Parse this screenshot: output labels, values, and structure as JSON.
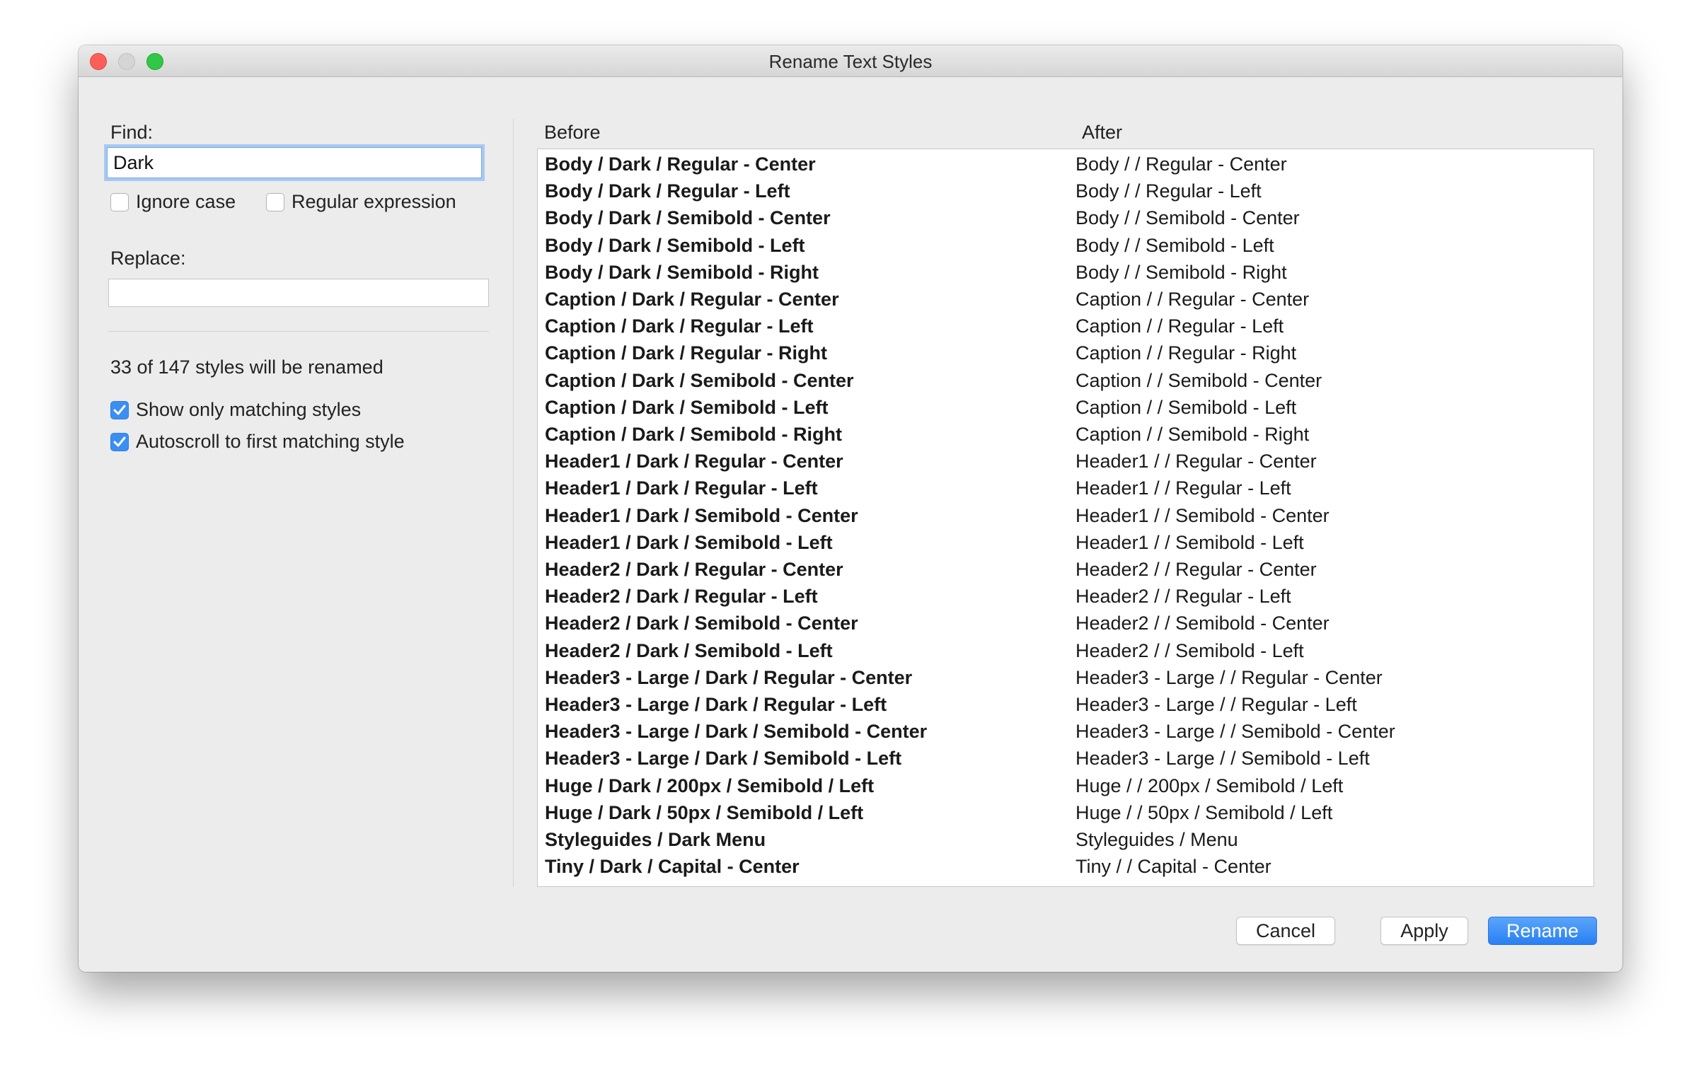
{
  "window": {
    "title": "Rename Text Styles"
  },
  "find": {
    "label": "Find:",
    "value": "Dark"
  },
  "options": {
    "ignore_case": "Ignore case",
    "regex": "Regular expression"
  },
  "replace": {
    "label": "Replace:",
    "value": ""
  },
  "summary": "33 of 147 styles will be renamed",
  "toggles": {
    "show_only": "Show only matching styles",
    "autoscroll": "Autoscroll to first matching style"
  },
  "table": {
    "headers": {
      "before": "Before",
      "after": "After"
    },
    "rows": [
      {
        "before": "Body / Dark / Regular - Center",
        "after": "Body /  / Regular - Center"
      },
      {
        "before": "Body / Dark / Regular - Left",
        "after": "Body /  / Regular - Left"
      },
      {
        "before": "Body / Dark / Semibold - Center",
        "after": "Body /  / Semibold - Center"
      },
      {
        "before": "Body / Dark / Semibold - Left",
        "after": "Body /  / Semibold - Left"
      },
      {
        "before": "Body / Dark / Semibold - Right",
        "after": "Body /  / Semibold - Right"
      },
      {
        "before": "Caption / Dark / Regular - Center",
        "after": "Caption /  / Regular - Center"
      },
      {
        "before": "Caption / Dark / Regular - Left",
        "after": "Caption /  / Regular - Left"
      },
      {
        "before": "Caption / Dark / Regular - Right",
        "after": "Caption /  / Regular - Right"
      },
      {
        "before": "Caption / Dark / Semibold - Center",
        "after": "Caption /  / Semibold - Center"
      },
      {
        "before": "Caption / Dark / Semibold - Left",
        "after": "Caption /  / Semibold - Left"
      },
      {
        "before": "Caption / Dark / Semibold - Right",
        "after": "Caption /  / Semibold - Right"
      },
      {
        "before": "Header1 / Dark / Regular - Center",
        "after": "Header1 /  / Regular - Center"
      },
      {
        "before": "Header1 / Dark / Regular - Left",
        "after": "Header1 /  / Regular - Left"
      },
      {
        "before": "Header1 / Dark / Semibold - Center",
        "after": "Header1 /  / Semibold - Center"
      },
      {
        "before": "Header1 / Dark / Semibold - Left",
        "after": "Header1 /  / Semibold - Left"
      },
      {
        "before": "Header2 / Dark / Regular - Center",
        "after": "Header2 /  / Regular - Center"
      },
      {
        "before": "Header2 / Dark / Regular - Left",
        "after": "Header2 /  / Regular - Left"
      },
      {
        "before": "Header2 / Dark / Semibold - Center",
        "after": "Header2 /  / Semibold - Center"
      },
      {
        "before": "Header2 / Dark / Semibold - Left",
        "after": "Header2 /  / Semibold - Left"
      },
      {
        "before": "Header3 - Large / Dark / Regular - Center",
        "after": "Header3 - Large /  / Regular - Center"
      },
      {
        "before": "Header3 - Large / Dark / Regular - Left",
        "after": "Header3 - Large /  / Regular - Left"
      },
      {
        "before": "Header3 - Large / Dark / Semibold - Center",
        "after": "Header3 - Large /  / Semibold - Center"
      },
      {
        "before": "Header3 - Large / Dark / Semibold - Left",
        "after": "Header3 - Large /  / Semibold - Left"
      },
      {
        "before": "Huge / Dark / 200px / Semibold / Left",
        "after": "Huge /  / 200px / Semibold / Left"
      },
      {
        "before": "Huge / Dark / 50px / Semibold / Left",
        "after": "Huge /  / 50px / Semibold / Left"
      },
      {
        "before": "Styleguides / Dark Menu",
        "after": "Styleguides /  Menu"
      },
      {
        "before": "Tiny / Dark / Capital - Center",
        "after": "Tiny /  / Capital - Center"
      }
    ]
  },
  "buttons": {
    "cancel": "Cancel",
    "apply": "Apply",
    "rename": "Rename"
  },
  "colors": {
    "accent": "#3b8ff3",
    "window_bg": "#ececec"
  }
}
